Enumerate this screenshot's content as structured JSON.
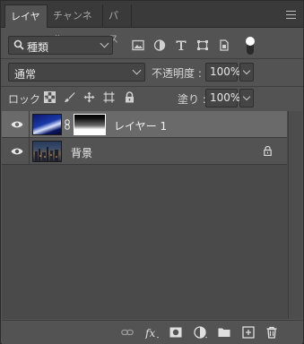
{
  "tabs": [
    {
      "label": "レイヤー",
      "active": true
    },
    {
      "label": "チャンネル",
      "active": false
    },
    {
      "label": "パス",
      "active": false
    }
  ],
  "filter": {
    "kind_label": "種類",
    "icons": [
      "image-filter-icon",
      "adjustment-filter-icon",
      "type-filter-icon",
      "shape-filter-icon",
      "smart-object-filter-icon"
    ]
  },
  "blend": {
    "mode": "通常",
    "opacity_label": "不透明度 :",
    "opacity_value": "100%"
  },
  "lock": {
    "label": "ロック :",
    "fill_label": "塗り :",
    "fill_value": "100%"
  },
  "layers": [
    {
      "name": "レイヤー 1",
      "selected": true,
      "has_mask": true
    },
    {
      "name": "背景",
      "selected": false,
      "locked": true
    }
  ],
  "colors": {
    "panel_bg": "#535353",
    "selected_row": "#6a6a6a",
    "tabbar_bg": "#3a3a3a"
  }
}
